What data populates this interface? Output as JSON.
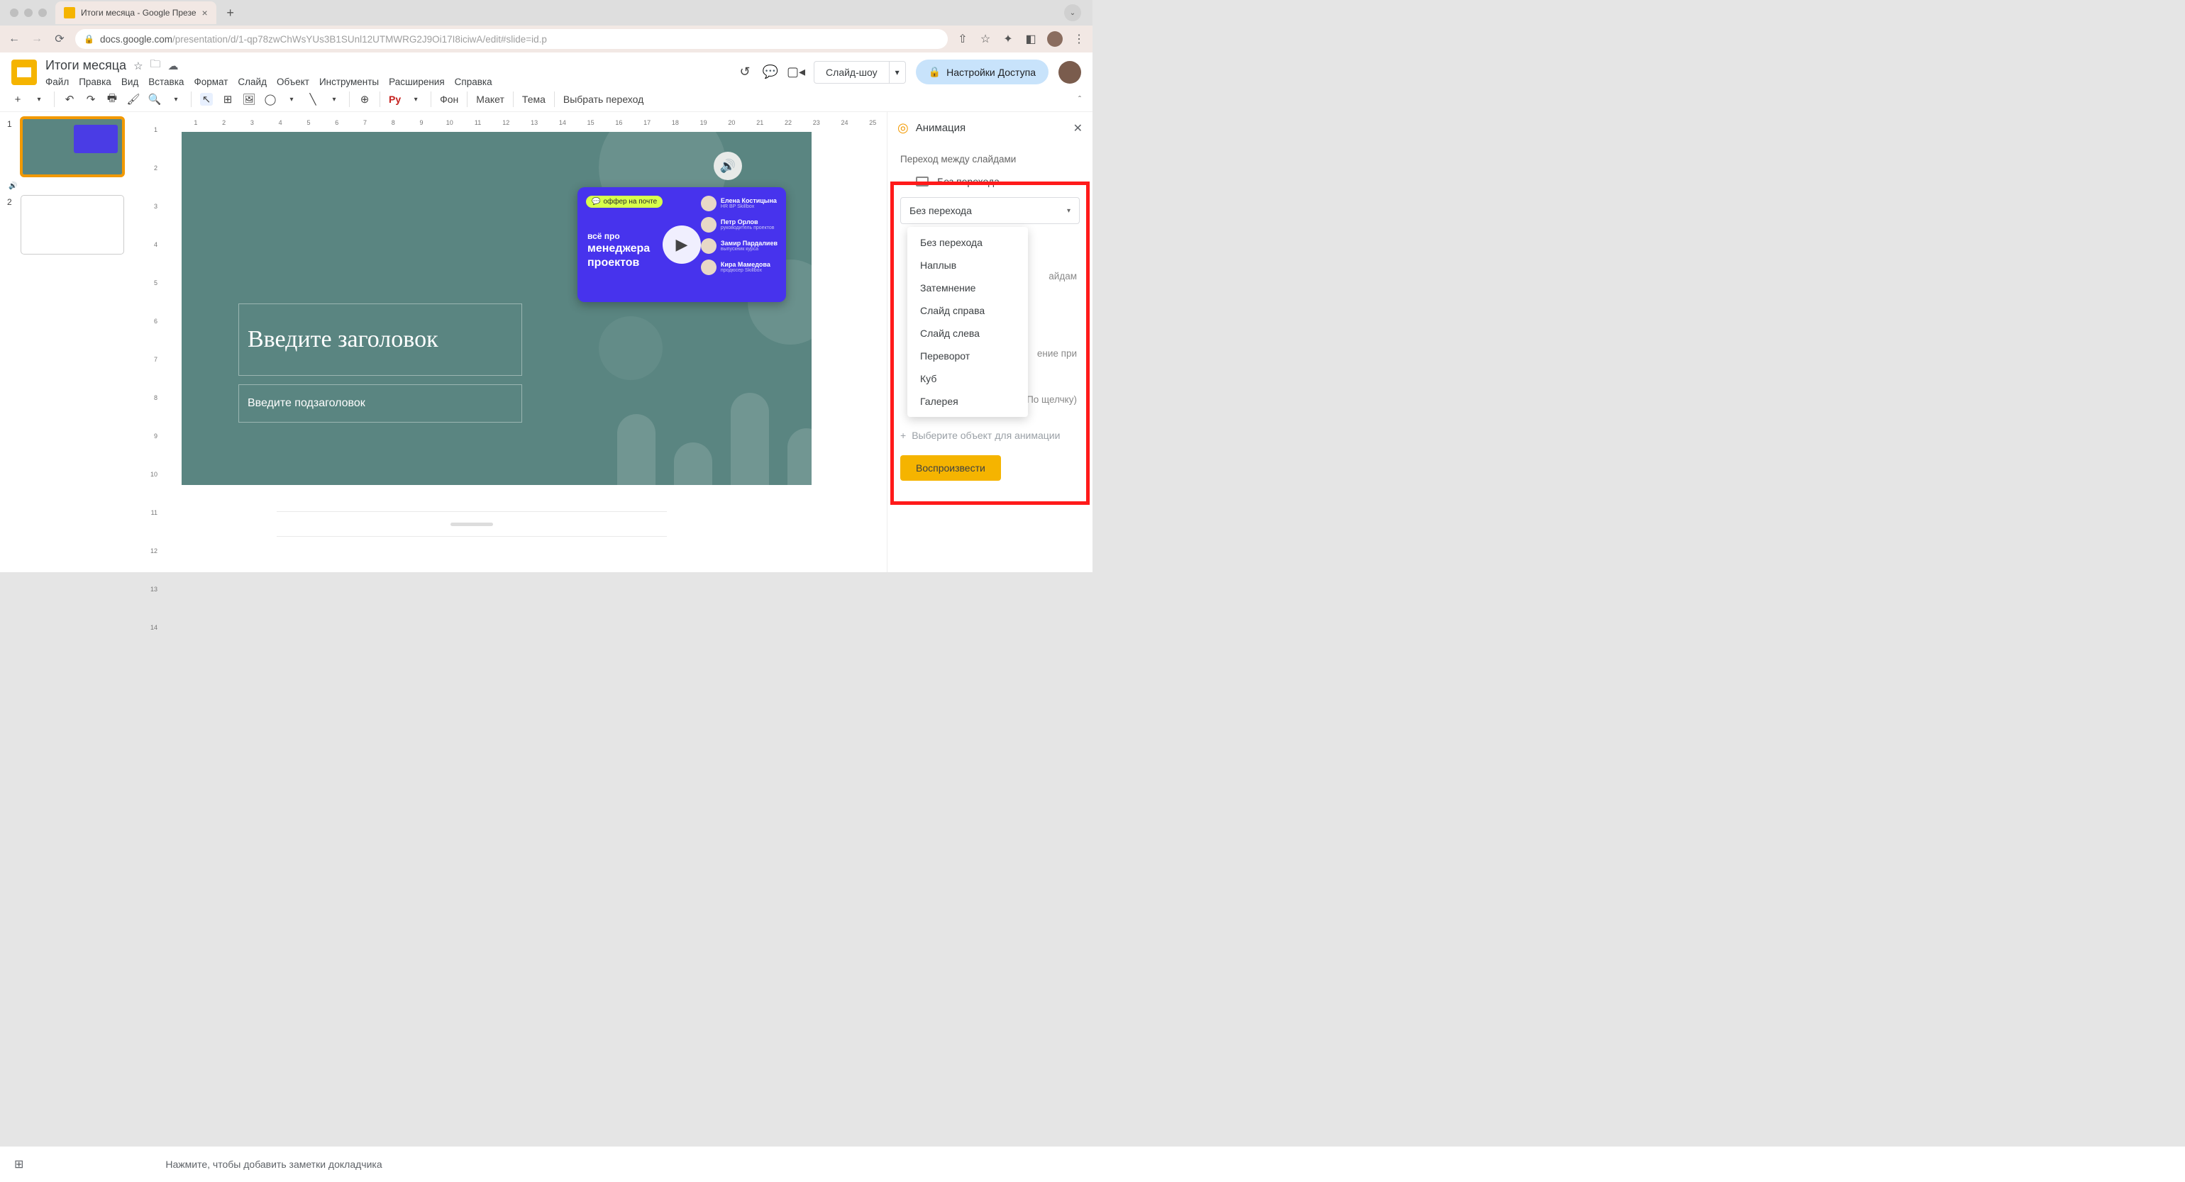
{
  "browser": {
    "tab_title": "Итоги месяца - Google Презе",
    "url_host": "docs.google.com",
    "url_path": "/presentation/d/1-qp78zwChWsYUs3B1SUnl12UTMWRG2J9Oi17I8iciwA/edit#slide=id.p"
  },
  "app": {
    "doc_title": "Итоги месяца",
    "menus": [
      "Файл",
      "Правка",
      "Вид",
      "Вставка",
      "Формат",
      "Слайд",
      "Объект",
      "Инструменты",
      "Расширения",
      "Справка"
    ],
    "slideshow": "Слайд-шоу",
    "share": "Настройки Доступа"
  },
  "toolbar": {
    "background_btn": "Фон",
    "layout_btn": "Макет",
    "theme_btn": "Тема",
    "transition_btn": "Выбрать переход",
    "paint_format": "Рy"
  },
  "ruler_h": [
    "1",
    "2",
    "3",
    "4",
    "5",
    "6",
    "7",
    "8",
    "9",
    "10",
    "11",
    "12",
    "13",
    "14",
    "15",
    "16",
    "17",
    "18",
    "19",
    "20",
    "21",
    "22",
    "23",
    "24",
    "25"
  ],
  "ruler_v": [
    "1",
    "2",
    "3",
    "4",
    "5",
    "6",
    "7",
    "8",
    "9",
    "10",
    "11",
    "12",
    "13",
    "14"
  ],
  "thumbs": [
    {
      "num": "1"
    },
    {
      "num": "2"
    }
  ],
  "slide": {
    "title_placeholder": "Введите заголовок",
    "subtitle_placeholder": "Введите подзаголовок",
    "video": {
      "offer": "оффер на почте",
      "line1": "всё про",
      "line2": "менеджера",
      "line3": "проектов",
      "people": [
        {
          "name": "Елена Костицына",
          "role": "HR BP Skillbox"
        },
        {
          "name": "Петр Орлов",
          "role": "руководитель проектов"
        },
        {
          "name": "Замир Пардалиев",
          "role": "выпускник курса"
        },
        {
          "name": "Кира Мамедова",
          "role": "продюсер Skillbox"
        }
      ]
    }
  },
  "anim_panel": {
    "title": "Анимация",
    "section": "Переход между слайдами",
    "current": "Без перехода",
    "select_label": "Без перехода",
    "options": [
      "Без перехода",
      "Наплыв",
      "Затемнение",
      "Слайд справа",
      "Слайд слева",
      "Переворот",
      "Куб",
      "Галерея"
    ],
    "behind_1": "айдам",
    "behind_2": "ение при",
    "behind_3": "По щелчку)",
    "add_object": "Выберите объект для анимации",
    "play": "Воспроизвести"
  },
  "bottom": {
    "speaker_hint": "Нажмите, чтобы добавить заметки докладчика"
  }
}
